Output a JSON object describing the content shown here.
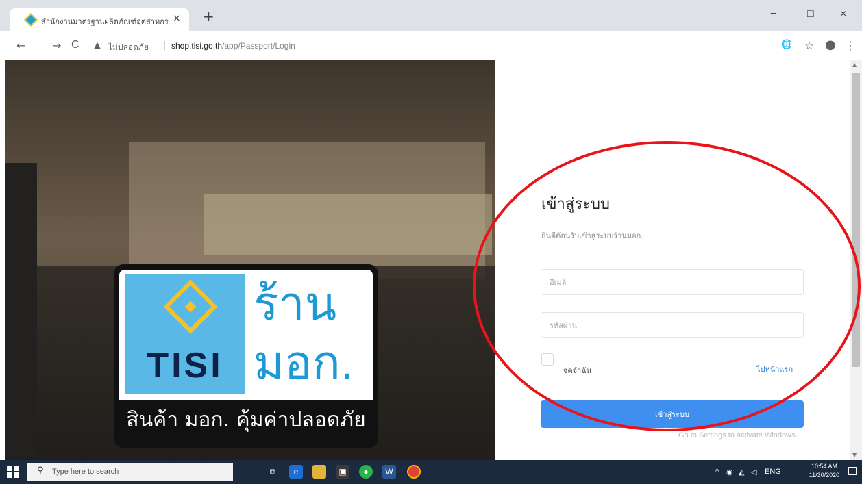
{
  "browser": {
    "tab_title": "สำนักงานมาตรฐานผลิตภัณฑ์อุตสาหกรรม",
    "tab_close": "×",
    "new_tab": "+",
    "minimize": "−",
    "maximize": "□",
    "close": "×",
    "back": "←",
    "forward": "→",
    "reload": "C",
    "security_icon": "warning-triangle",
    "security_label": "ไม่ปลอดภัย",
    "url_host": "shop.tisi.go.th",
    "url_path": "/app/Passport/Login"
  },
  "hero": {
    "logo_brand": "TISI",
    "logo_shop": "ร้าน",
    "logo_mok": "มอก.",
    "logo_slogan": "สินค้า มอก. คุ้มค่าปลอดภัย"
  },
  "login": {
    "title": "เข้าสู่ระบบ",
    "subtitle": "ยินดีต้อนรับเข้าสู่ระบบร้านมอก.",
    "email_placeholder": "อีเมล์",
    "password_placeholder": "รหัสผ่าน",
    "remember_label": "จดจำฉัน",
    "home_link": "ไปหน้าแรก",
    "submit_label": "เข้าสู่ระบบ"
  },
  "watermark": "Go to Settings to activate Windows.",
  "taskbar": {
    "search_placeholder": "Type here to search",
    "language": "ENG",
    "time": "10:54 AM",
    "date": "11/30/2020"
  },
  "colors": {
    "primary_button": "#3e8ff0",
    "annotation_ellipse": "#e8141a",
    "link": "#1c7ed6"
  }
}
